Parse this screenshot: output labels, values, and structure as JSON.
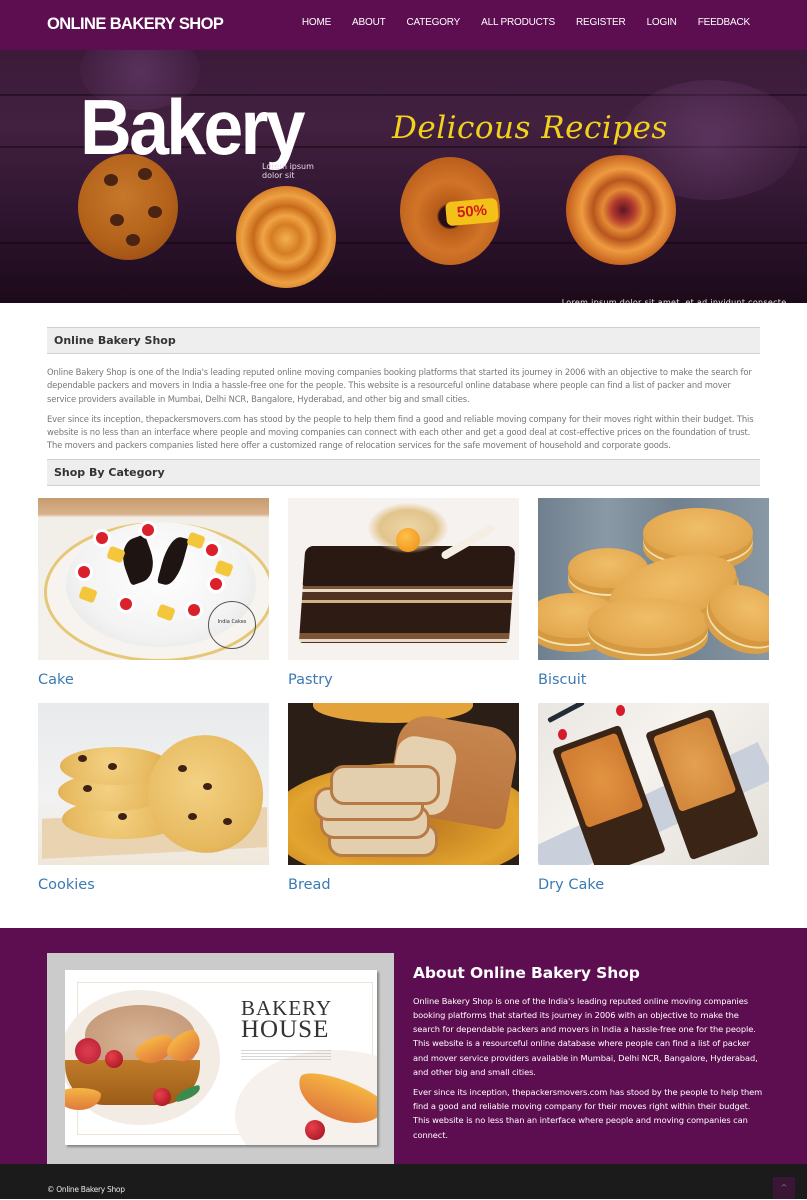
{
  "header": {
    "logo": "ONLINE BAKERY SHOP",
    "nav": [
      "HOME",
      "ABOUT",
      "CATEGORY",
      "ALL PRODUCTS",
      "REGISTER",
      "LOGIN",
      "FEEDBACK"
    ]
  },
  "banner": {
    "title": "Bakery",
    "script": "Delicous Recipes",
    "lorem_line1": "Lorem ipsum",
    "lorem_line2": "dolor sit",
    "badge": "50%",
    "caption": "Lorem ipsum dolor sit amet, et ad invidunt consecte..."
  },
  "intro": {
    "heading": "Online Bakery Shop",
    "paragraphs": [
      "Online Bakery Shop is one of the India's leading reputed online moving companies booking platforms that started its journey in 2006 with an objective to make the search for dependable packers and movers in India a hassle-free one for the people. This website is a resourceful online database where people can find a list of packer and mover service providers available in Mumbai, Delhi NCR, Bangalore, Hyderabad, and other big and small cities.",
      "Ever since its inception, thepackersmovers.com has stood by the people to help them find a good and reliable moving company for their moves right within their budget. This website is no less than an interface where people and moving companies can connect with each other and get a good deal at cost-effective prices on the foundation of trust. The movers and packers companies listed here offer a customized range of relocation services for the safe movement of household and corporate goods."
    ]
  },
  "categories": {
    "heading": "Shop By Category",
    "items": [
      {
        "label": "Cake",
        "image": "cake-photo"
      },
      {
        "label": "Pastry",
        "image": "pastry-photo"
      },
      {
        "label": "Biscuit",
        "image": "biscuit-photo"
      },
      {
        "label": "Cookies",
        "image": "cookies-photo"
      },
      {
        "label": "Bread",
        "image": "bread-photo"
      },
      {
        "label": "Dry Cake",
        "image": "dry-cake-photo"
      }
    ],
    "cake_stamp": "India Cakes"
  },
  "about": {
    "image_line1": "BAKERY",
    "image_line2": "HOUSE",
    "title": "About Online Bakery Shop",
    "paragraphs": [
      "Online Bakery Shop is one of the India's leading reputed online moving companies booking platforms that started its journey in 2006 with an objective to make the search for dependable packers and movers in India a hassle-free one for the people. This website is a resourceful online database where people can find a list of packer and mover service providers available in Mumbai, Delhi NCR, Bangalore, Hyderabad, and other big and small cities.",
      "Ever since its inception, thepackersmovers.com has stood by the people to help them find a good and reliable moving company for their moves right within their budget. This website is no less than an interface where people and moving companies can connect."
    ]
  },
  "footer": {
    "copyright": "© Online Bakery Shop",
    "to_top_icon": "chevron-up-icon",
    "to_top_glyph": "^"
  },
  "colors": {
    "brand_purple": "#5d0e50",
    "link_blue": "#3b7ab3",
    "footer_dark": "#1b1b1b",
    "section_bar": "#eeeeee"
  }
}
